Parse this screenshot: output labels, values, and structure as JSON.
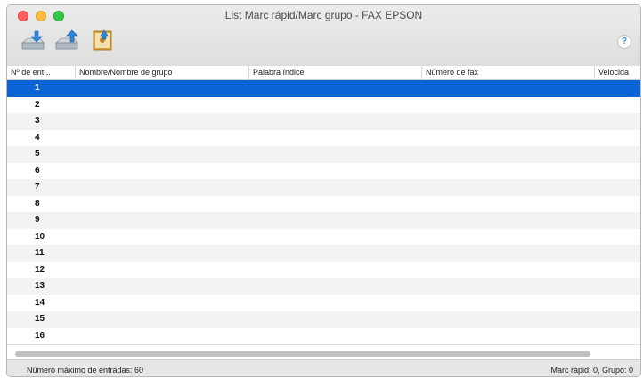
{
  "window": {
    "title": "List Marc rápid/Marc grupo - FAX EPSON"
  },
  "toolbar": {
    "buttons": [
      {
        "icon": "import-tray-icon"
      },
      {
        "icon": "export-tray-icon"
      },
      {
        "icon": "address-book-upload-icon"
      }
    ],
    "help_label": "?"
  },
  "table": {
    "columns": [
      "Nº de ent...",
      "Nombre/Nombre de grupo",
      "Palabra índice",
      "Número de fax",
      "Velocida"
    ],
    "rows": [
      "1",
      "2",
      "3",
      "4",
      "5",
      "6",
      "7",
      "8",
      "9",
      "10",
      "11",
      "12",
      "13",
      "14",
      "15",
      "16"
    ],
    "selected_row": "1"
  },
  "status": {
    "left": "Número máximo de entradas: 60",
    "right": "Marc rápid: 0, Grupo: 0"
  },
  "colors": {
    "selection": "#0b64d6"
  }
}
